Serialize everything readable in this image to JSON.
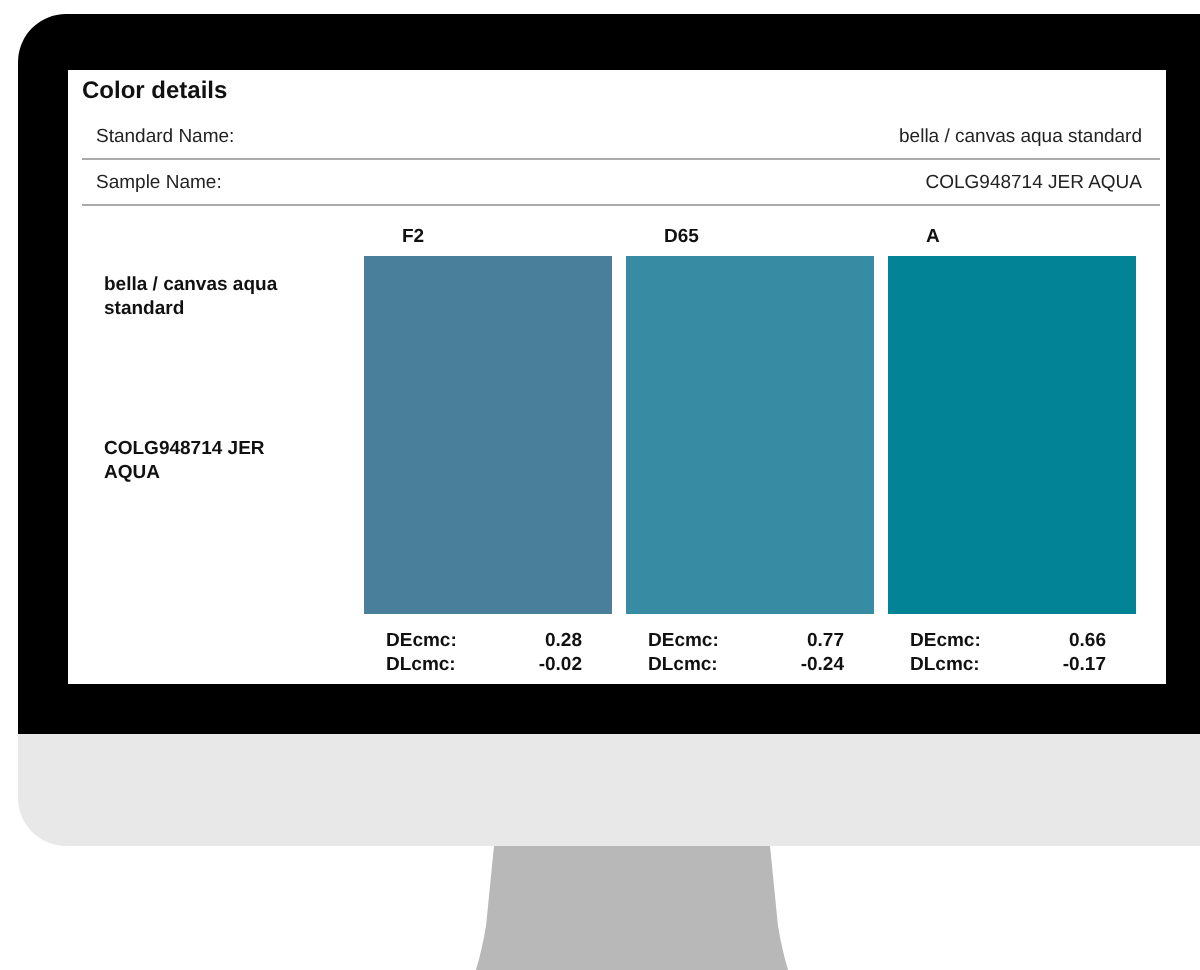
{
  "title": "Color details",
  "fields": [
    {
      "label": "Standard Name:",
      "value": "bella / canvas aqua standard"
    },
    {
      "label": "Sample Name:",
      "value": "COLG948714 JER AQUA"
    }
  ],
  "names": [
    "bella / canvas aqua standard",
    "COLG948714 JER AQUA"
  ],
  "illuminants": [
    {
      "name": "F2",
      "color": "#4a7f9c",
      "stats": [
        {
          "label": "DEcmc:",
          "value": "0.28"
        },
        {
          "label": "DLcmc:",
          "value": "-0.02"
        }
      ]
    },
    {
      "name": "D65",
      "color": "#378ca3",
      "stats": [
        {
          "label": "DEcmc:",
          "value": "0.77"
        },
        {
          "label": "DLcmc:",
          "value": "-0.24"
        }
      ]
    },
    {
      "name": "A",
      "color": "#028396",
      "stats": [
        {
          "label": "DEcmc:",
          "value": "0.66"
        },
        {
          "label": "DLcmc:",
          "value": "-0.17"
        }
      ]
    }
  ]
}
